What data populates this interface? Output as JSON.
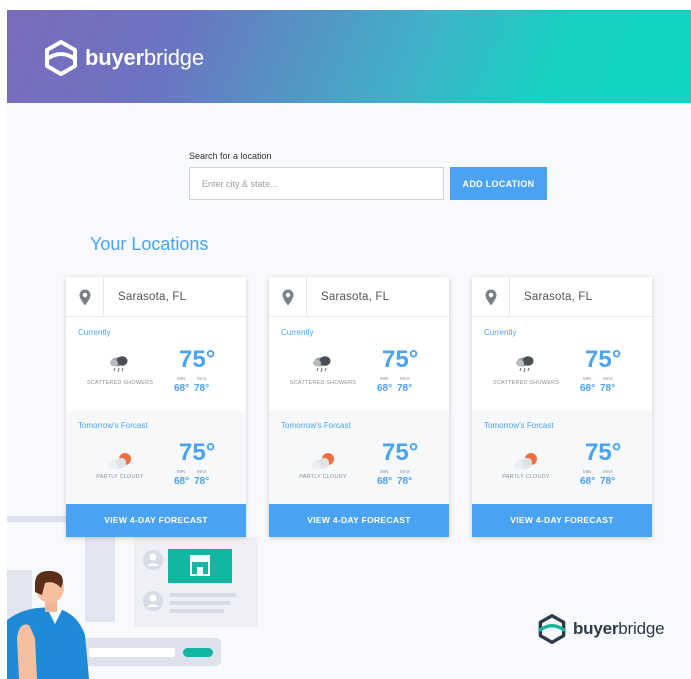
{
  "brand": {
    "name_bold": "buyer",
    "name_rest": "bridge"
  },
  "search": {
    "label": "Search for a location",
    "placeholder": "Enter city & state...",
    "button_label": "ADD LOCATION"
  },
  "locations": {
    "title": "Your Locations",
    "cards": [
      {
        "city": "Sarasota, FL",
        "current": {
          "label": "Currently",
          "condition": "SCATTERED SHOWERS",
          "temp": "75°",
          "min_label": "MIN",
          "max_label": "MAX",
          "min": "68°",
          "max": "78°",
          "icon": "showers-icon"
        },
        "tomorrow": {
          "label": "Tomorrow's Forcast",
          "condition": "PARTLY CLOUDY",
          "temp": "75°",
          "min_label": "MIN",
          "max_label": "MAX",
          "min": "68°",
          "max": "78°",
          "icon": "partly-cloudy-icon"
        },
        "button_label": "VIEW 4-DAY FORECAST"
      },
      {
        "city": "Sarasota, FL",
        "current": {
          "label": "Currently",
          "condition": "SCATTERED SHOWERS",
          "temp": "75°",
          "min_label": "MIN",
          "max_label": "MAX",
          "min": "68°",
          "max": "78°",
          "icon": "showers-icon"
        },
        "tomorrow": {
          "label": "Tomorrow's Forcast",
          "condition": "PARTLY CLOUDY",
          "temp": "75°",
          "min_label": "MIN",
          "max_label": "MAX",
          "min": "68°",
          "max": "78°",
          "icon": "partly-cloudy-icon"
        },
        "button_label": "VIEW 4-DAY FORECAST"
      },
      {
        "city": "Sarasota, FL",
        "current": {
          "label": "Currently",
          "condition": "SCATTERED SHOWERS",
          "temp": "75°",
          "min_label": "MIN",
          "max_label": "MAX",
          "min": "68°",
          "max": "78°",
          "icon": "showers-icon"
        },
        "tomorrow": {
          "label": "Tomorrow's Forcast",
          "condition": "PARTLY CLOUDY",
          "temp": "75°",
          "min_label": "MIN",
          "max_label": "MAX",
          "min": "68°",
          "max": "78°",
          "icon": "partly-cloudy-icon"
        },
        "button_label": "VIEW 4-DAY FORECAST"
      }
    ]
  },
  "colors": {
    "accent": "#4aa3f2",
    "teal": "#12b5a0",
    "header_start": "#7a6cbb",
    "header_end": "#10d6c1"
  },
  "icons": {
    "location": "map-pin-icon",
    "brand": "buyerbridge-logo-icon",
    "store": "storefront-icon"
  }
}
